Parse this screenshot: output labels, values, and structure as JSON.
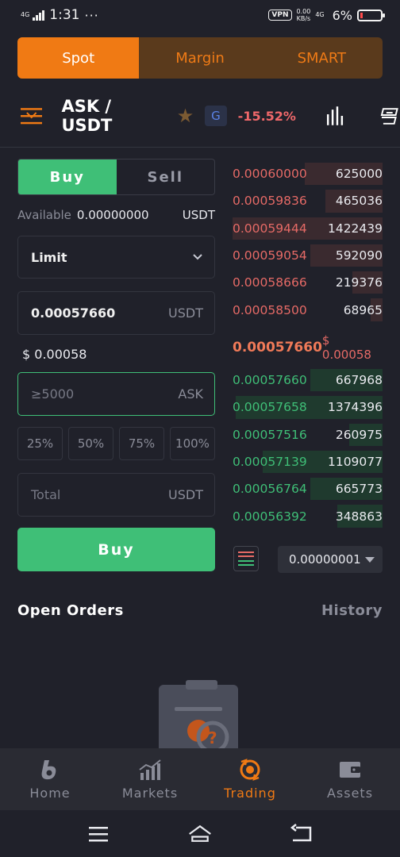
{
  "status_bar": {
    "network": "4G",
    "time": "1:31",
    "dots": "···",
    "vpn": "VPN",
    "speed_value": "0.00",
    "speed_unit": "KB/s",
    "net_right": "4G",
    "battery": "6%"
  },
  "market_tabs": [
    {
      "label": "Spot",
      "active": true
    },
    {
      "label": "Margin",
      "active": false
    },
    {
      "label": "SMART",
      "active": false
    }
  ],
  "pair": {
    "name": "ASK / USDT",
    "badge": "G",
    "change": "-15.52%"
  },
  "order_form": {
    "buy_tab": "Buy",
    "sell_tab": "Sell",
    "available_label": "Available",
    "available_value": "0.00000000",
    "available_currency": "USDT",
    "order_type": "Limit",
    "price_value": "0.00057660",
    "price_unit": "USDT",
    "price_usd": "$ 0.00058",
    "amount_placeholder": "≥5000",
    "amount_unit": "ASK",
    "percent_options": [
      "25%",
      "50%",
      "75%",
      "100%"
    ],
    "total_placeholder": "Total",
    "total_unit": "USDT",
    "submit_label": "Buy"
  },
  "order_book": {
    "asks": [
      {
        "price": "0.00060000",
        "qty": "625000",
        "depth": 0.52
      },
      {
        "price": "0.00059836",
        "qty": "465036",
        "depth": 0.38
      },
      {
        "price": "0.00059444",
        "qty": "1422439",
        "depth": 1.0
      },
      {
        "price": "0.00059054",
        "qty": "592090",
        "depth": 0.48
      },
      {
        "price": "0.00058666",
        "qty": "219376",
        "depth": 0.2
      },
      {
        "price": "0.00058500",
        "qty": "68965",
        "depth": 0.08
      }
    ],
    "last_price": "0.00057660",
    "last_price_usd": "$ 0.00058",
    "bids": [
      {
        "price": "0.00057660",
        "qty": "667968",
        "depth": 0.48
      },
      {
        "price": "0.00057658",
        "qty": "1374396",
        "depth": 0.98
      },
      {
        "price": "0.00057516",
        "qty": "260975",
        "depth": 0.22
      },
      {
        "price": "0.00057139",
        "qty": "1109077",
        "depth": 0.8
      },
      {
        "price": "0.00056764",
        "qty": "665773",
        "depth": 0.48
      },
      {
        "price": "0.00056392",
        "qty": "348863",
        "depth": 0.3
      }
    ],
    "precision": "0.00000001"
  },
  "open_orders": {
    "title": "Open Orders",
    "history": "History"
  },
  "bottom_nav": [
    {
      "label": "Home",
      "icon": "home-logo-icon",
      "active": false
    },
    {
      "label": "Markets",
      "icon": "markets-chart-icon",
      "active": false
    },
    {
      "label": "Trading",
      "icon": "trading-icon",
      "active": true
    },
    {
      "label": "Assets",
      "icon": "wallet-icon",
      "active": false
    }
  ],
  "colors": {
    "accent": "#f07a14",
    "buy": "#3fbf77",
    "sell": "#e66a66",
    "background": "#20212a"
  }
}
